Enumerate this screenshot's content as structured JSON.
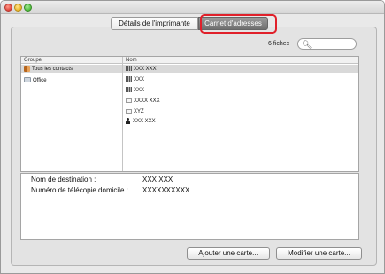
{
  "tabs": [
    {
      "label": "Détails de l'imprimante",
      "selected": false
    },
    {
      "label": "Carnet d'adresses",
      "selected": true
    }
  ],
  "accent": {
    "highlight": "#e0202a"
  },
  "toolbar": {
    "count": "6 fiches",
    "search_placeholder": "",
    "search_icon": "search-icon"
  },
  "list": {
    "group_header": "Groupe",
    "name_header": "Nom",
    "groups": [
      {
        "label": "Tous les contacts",
        "icon": "address-book-icon",
        "selected": true
      },
      {
        "label": "Office",
        "icon": "group-folder-icon",
        "selected": false
      }
    ],
    "contacts": [
      {
        "label": "XXX XXX",
        "icon": "company-icon",
        "selected": true
      },
      {
        "label": "XXX",
        "icon": "company-icon",
        "selected": false
      },
      {
        "label": "XXX",
        "icon": "company-icon",
        "selected": false
      },
      {
        "label": "XXXX XXX",
        "icon": "card-icon",
        "selected": false
      },
      {
        "label": "XYZ",
        "icon": "card-icon",
        "selected": false
      },
      {
        "label": "XXX XXX",
        "icon": "person-icon",
        "selected": false
      }
    ]
  },
  "detail": {
    "destination_label": "Nom de destination :",
    "destination_value": "XXX XXX",
    "fax_label": "Numéro de télécopie domicile :",
    "fax_value": "XXXXXXXXXX"
  },
  "buttons": {
    "add": "Ajouter une carte...",
    "edit": "Modifier une carte..."
  }
}
